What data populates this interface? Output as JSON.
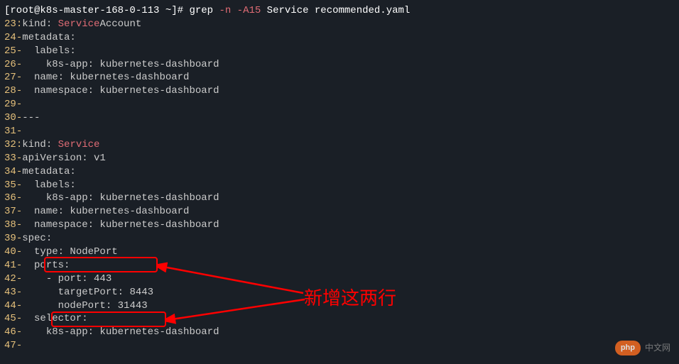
{
  "prompt": {
    "user_host": "[root@k8s-master-168-0-113 ~]# ",
    "cmd": "grep ",
    "flags": "-n -A15",
    "args": " Service recommended.yaml"
  },
  "lines": [
    {
      "num": "23",
      "sep": ":",
      "pre": "kind: ",
      "hl": "Service",
      "post": "Account"
    },
    {
      "num": "24",
      "sep": "-",
      "pre": "metadata:",
      "hl": "",
      "post": ""
    },
    {
      "num": "25",
      "sep": "-",
      "pre": "  labels:",
      "hl": "",
      "post": ""
    },
    {
      "num": "26",
      "sep": "-",
      "pre": "    k8s-app: kubernetes-dashboard",
      "hl": "",
      "post": ""
    },
    {
      "num": "27",
      "sep": "-",
      "pre": "  name: kubernetes-dashboard",
      "hl": "",
      "post": ""
    },
    {
      "num": "28",
      "sep": "-",
      "pre": "  namespace: kubernetes-dashboard",
      "hl": "",
      "post": ""
    },
    {
      "num": "29",
      "sep": "-",
      "pre": "",
      "hl": "",
      "post": ""
    },
    {
      "num": "30",
      "sep": "-",
      "pre": "---",
      "hl": "",
      "post": ""
    },
    {
      "num": "31",
      "sep": "-",
      "pre": "",
      "hl": "",
      "post": ""
    },
    {
      "num": "32",
      "sep": ":",
      "pre": "kind: ",
      "hl": "Service",
      "post": ""
    },
    {
      "num": "33",
      "sep": "-",
      "pre": "apiVersion: v1",
      "hl": "",
      "post": ""
    },
    {
      "num": "34",
      "sep": "-",
      "pre": "metadata:",
      "hl": "",
      "post": ""
    },
    {
      "num": "35",
      "sep": "-",
      "pre": "  labels:",
      "hl": "",
      "post": ""
    },
    {
      "num": "36",
      "sep": "-",
      "pre": "    k8s-app: kubernetes-dashboard",
      "hl": "",
      "post": ""
    },
    {
      "num": "37",
      "sep": "-",
      "pre": "  name: kubernetes-dashboard",
      "hl": "",
      "post": ""
    },
    {
      "num": "38",
      "sep": "-",
      "pre": "  namespace: kubernetes-dashboard",
      "hl": "",
      "post": ""
    },
    {
      "num": "39",
      "sep": "-",
      "pre": "spec:",
      "hl": "",
      "post": ""
    },
    {
      "num": "40",
      "sep": "-",
      "pre": "  type: NodePort",
      "hl": "",
      "post": ""
    },
    {
      "num": "41",
      "sep": "-",
      "pre": "  ports:",
      "hl": "",
      "post": ""
    },
    {
      "num": "42",
      "sep": "-",
      "pre": "    - port: 443",
      "hl": "",
      "post": ""
    },
    {
      "num": "43",
      "sep": "-",
      "pre": "      targetPort: 8443",
      "hl": "",
      "post": ""
    },
    {
      "num": "44",
      "sep": "-",
      "pre": "      nodePort: 31443",
      "hl": "",
      "post": ""
    },
    {
      "num": "45",
      "sep": "-",
      "pre": "  selector:",
      "hl": "",
      "post": ""
    },
    {
      "num": "46",
      "sep": "-",
      "pre": "    k8s-app: kubernetes-dashboard",
      "hl": "",
      "post": ""
    },
    {
      "num": "47",
      "sep": "-",
      "pre": "",
      "hl": "",
      "post": ""
    }
  ],
  "annotation": {
    "text": "新增这两行"
  },
  "watermark": {
    "badge": "php",
    "text": "中文网"
  }
}
